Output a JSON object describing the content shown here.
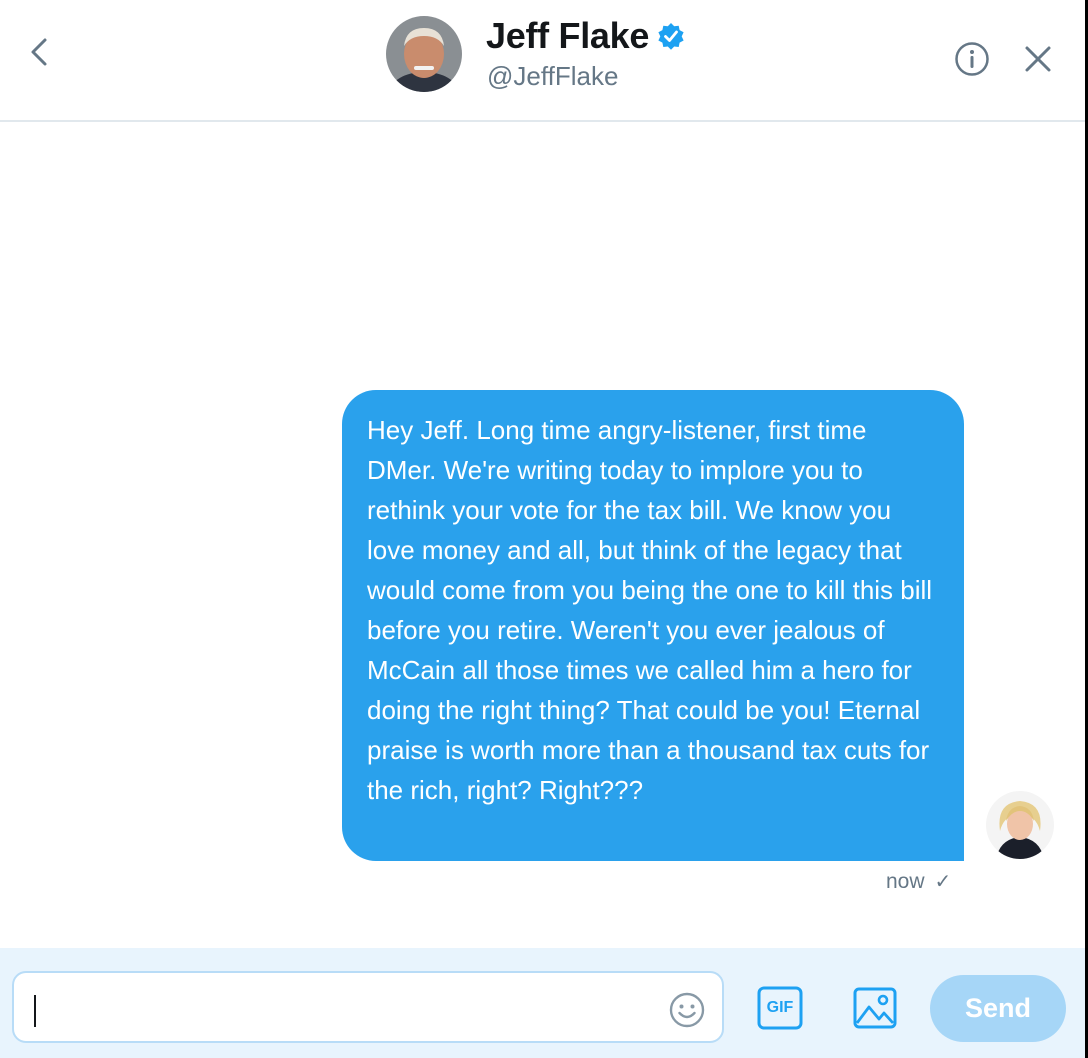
{
  "header": {
    "back_icon": "chevron-left-icon",
    "display_name": "Jeff Flake",
    "handle": "@JeffFlake",
    "verified": true,
    "info_icon": "info-icon",
    "close_icon": "close-icon"
  },
  "conversation": {
    "messages": [
      {
        "direction": "outgoing",
        "text": "Hey Jeff. Long time angry-listener, first time DMer. We're writing today to implore you to rethink your vote for the tax bill. We know you love money and all, but think of the legacy that would come from you being the one to kill this bill before you retire. Weren't you ever jealous of McCain all those times we called him a hero for doing the right thing? That could be you! Eternal praise is worth more than a thousand tax cuts for the rich, right? Right???",
        "timestamp": "now",
        "status_icon": "check-icon"
      }
    ]
  },
  "composer": {
    "input_value": "",
    "emoji_icon": "emoji-icon",
    "gif_label": "GIF",
    "image_icon": "image-icon",
    "send_label": "Send"
  },
  "colors": {
    "accent": "#1da1f2",
    "bubble": "#2aa1ec",
    "send_disabled": "#a6d6f7",
    "composer_bg": "#e8f4fd",
    "muted_text": "#657786"
  }
}
